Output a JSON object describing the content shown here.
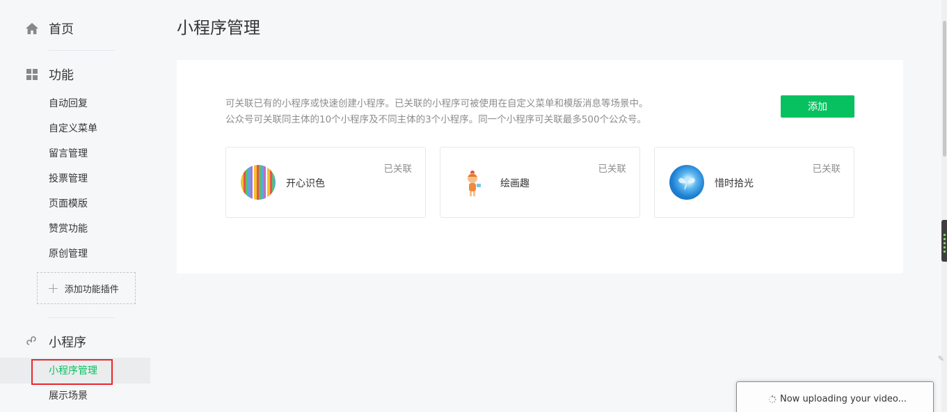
{
  "sidebar": {
    "home": {
      "label": "首页",
      "icon": "home-icon"
    },
    "features": {
      "label": "功能",
      "icon": "grid-icon",
      "items": [
        "自动回复",
        "自定义菜单",
        "留言管理",
        "投票管理",
        "页面模版",
        "赞赏功能",
        "原创管理"
      ],
      "add_plugin": "添加功能插件"
    },
    "mini_program": {
      "label": "小程序",
      "icon": "link-icon",
      "items": [
        "小程序管理",
        "展示场景"
      ],
      "active_index": 0
    }
  },
  "main": {
    "title": "小程序管理",
    "description": [
      "可关联已有的小程序或快速创建小程序。已关联的小程序可被使用在自定义菜单和模版消息等场景中。",
      "公众号可关联同主体的10个小程序及不同主体的3个小程序。同一个小程序可关联最多500个公众号。"
    ],
    "add_button": "添加",
    "cards": [
      {
        "name": "开心识色",
        "status": "已关联",
        "avatar": "stripes-avatar"
      },
      {
        "name": "绘画趣",
        "status": "已关联",
        "avatar": "cartoon-girl-avatar"
      },
      {
        "name": "惜时拾光",
        "status": "已关联",
        "avatar": "blue-butterfly-avatar"
      }
    ]
  },
  "toast": {
    "text": "Now uploading your video..."
  },
  "colors": {
    "accent": "#07c160",
    "highlight": "#e8262c",
    "muted": "#8d8d8d"
  }
}
